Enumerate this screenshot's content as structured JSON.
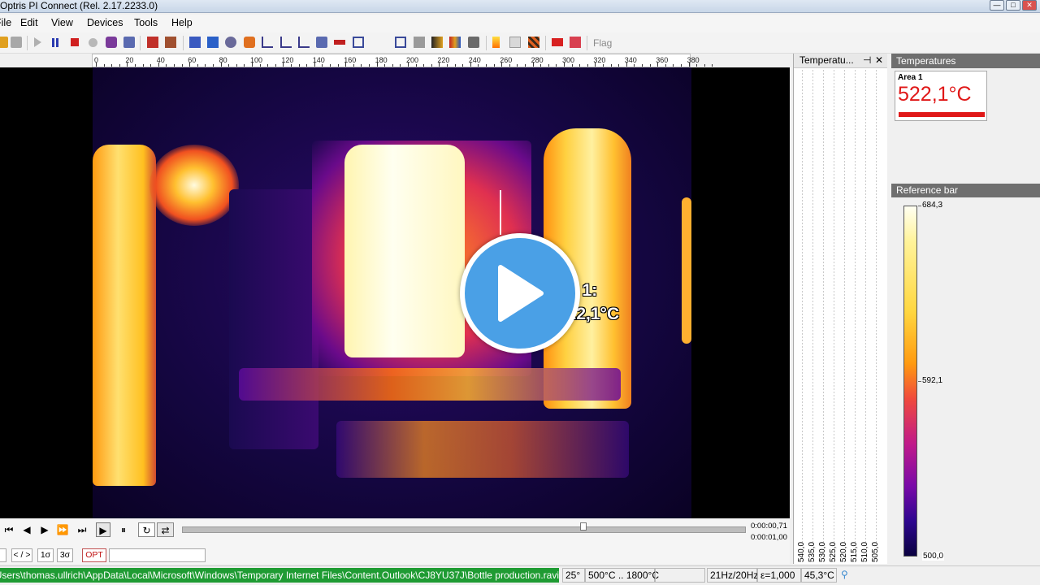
{
  "window": {
    "title": "Optris PI Connect (Rel. 2.17.2233.0)",
    "controls": [
      "—",
      "□",
      "✕"
    ]
  },
  "menu": [
    "File",
    "Edit",
    "View",
    "Devices",
    "Tools",
    "Help"
  ],
  "toolbar": {
    "flag_label": "Flag"
  },
  "ruler": {
    "labels": [
      "0",
      "20",
      "40",
      "60",
      "80",
      "100",
      "120",
      "140",
      "160",
      "180",
      "200",
      "220",
      "240",
      "260",
      "280",
      "300",
      "320",
      "340",
      "360",
      "380"
    ]
  },
  "view": {
    "area_label": "Area 1:",
    "area_value": "522,1°C"
  },
  "playback": {
    "time_current": "0:00:00,71",
    "time_total": "0:00:01,00",
    "position": 0.71
  },
  "bottom_buttons": [
    "< / >",
    "1σ",
    "3σ",
    "OPT"
  ],
  "status": {
    "path": "C:\\Users\\thomas.ullrich\\AppData\\Local\\Microsoft\\Windows\\Temporary Internet Files\\Content.Outlook\\CJ8YU37J\\Bottle production.ravi",
    "fov": "25°",
    "range": "500°C .. 1800°C",
    "empty": "",
    "framerate": "21Hz/20Hz",
    "emissivity": "ε=1,000",
    "ambient": "45,3°C"
  },
  "graph_panel": {
    "title": "Temperatu...",
    "pin": "⊣",
    "close": "✕",
    "y_labels": [
      "540,0",
      "535,0",
      "530,0",
      "525,0",
      "520,0",
      "515,0",
      "510,0",
      "505,0"
    ]
  },
  "temperatures_panel": {
    "title": "Temperatures",
    "area_name": "Area 1",
    "area_value": "522,1°C",
    "color": "#e01818"
  },
  "reference_bar": {
    "title": "Reference bar",
    "max": "684,3",
    "mid": "592,1",
    "min": "500,0"
  }
}
